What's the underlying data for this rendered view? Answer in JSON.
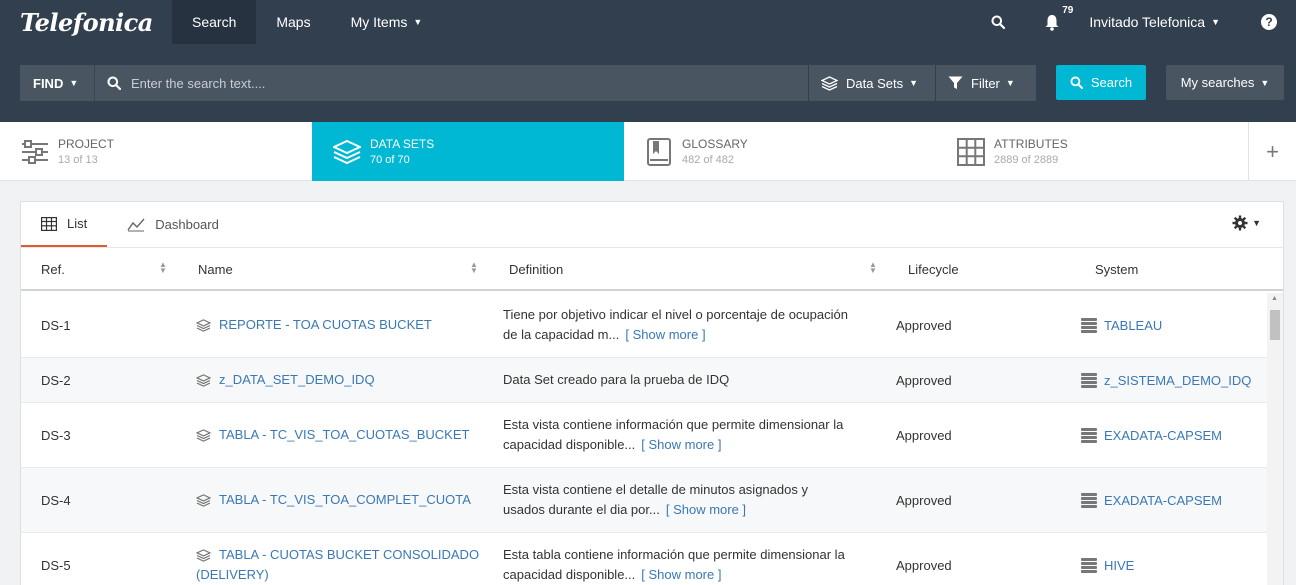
{
  "topnav": {
    "logo": "Telefonica",
    "items": [
      {
        "label": "Search"
      },
      {
        "label": "Maps"
      },
      {
        "label": "My Items"
      }
    ],
    "notifications_count": "79",
    "user": "Invitado Telefonica",
    "help": "?"
  },
  "searchbar": {
    "find_label": "FIND",
    "placeholder": "Enter the search text....",
    "type_label": "Data Sets",
    "filter_label": "Filter",
    "search_button": "Search",
    "my_searches": "My searches"
  },
  "categories": [
    {
      "title": "PROJECT",
      "count": "13 of 13"
    },
    {
      "title": "DATA SETS",
      "count": "70 of 70"
    },
    {
      "title": "GLOSSARY",
      "count": "482 of 482"
    },
    {
      "title": "ATTRIBUTES",
      "count": "2889 of 2889"
    }
  ],
  "add_category": "+",
  "views": {
    "list": "List",
    "dashboard": "Dashboard"
  },
  "columns": {
    "ref": "Ref.",
    "name": "Name",
    "definition": "Definition",
    "lifecycle": "Lifecycle",
    "system": "System"
  },
  "rows": [
    {
      "ref": "DS-1",
      "name": "REPORTE - TOA CUOTAS BUCKET",
      "name2": "",
      "def1": "Tiene por objetivo indicar el nivel o porcentaje de ocupación",
      "def2": "de la capacidad m...",
      "show_more": "[ Show more ]",
      "lifecycle": "Approved",
      "system": "TABLEAU"
    },
    {
      "ref": "DS-2",
      "name": "z_DATA_SET_DEMO_IDQ",
      "name2": "",
      "def1": "Data Set creado para la prueba de IDQ",
      "def2": "",
      "show_more": "",
      "lifecycle": "Approved",
      "system": "z_SISTEMA_DEMO_IDQ"
    },
    {
      "ref": "DS-3",
      "name": "TABLA - TC_VIS_TOA_CUOTAS_BUCKET",
      "name2": "",
      "def1": "Esta vista contiene información que permite dimensionar la",
      "def2": "capacidad disponible...",
      "show_more": "[ Show more ]",
      "lifecycle": "Approved",
      "system": "EXADATA-CAPSEM"
    },
    {
      "ref": "DS-4",
      "name": "TABLA - TC_VIS_TOA_COMPLET_CUOTA",
      "name2": "",
      "def1": "Esta vista contiene el detalle de minutos asignados y",
      "def2": "usados durante el dia por...",
      "show_more": "[ Show more ]",
      "lifecycle": "Approved",
      "system": "EXADATA-CAPSEM"
    },
    {
      "ref": "DS-5",
      "name": "TABLA - CUOTAS BUCKET CONSOLIDADO",
      "name2": "(DELIVERY)",
      "def1": "Esta tabla contiene información que permite dimensionar la",
      "def2": "capacidad disponible...",
      "show_more": "[ Show more ]",
      "lifecycle": "Approved",
      "system": "HIVE"
    }
  ]
}
